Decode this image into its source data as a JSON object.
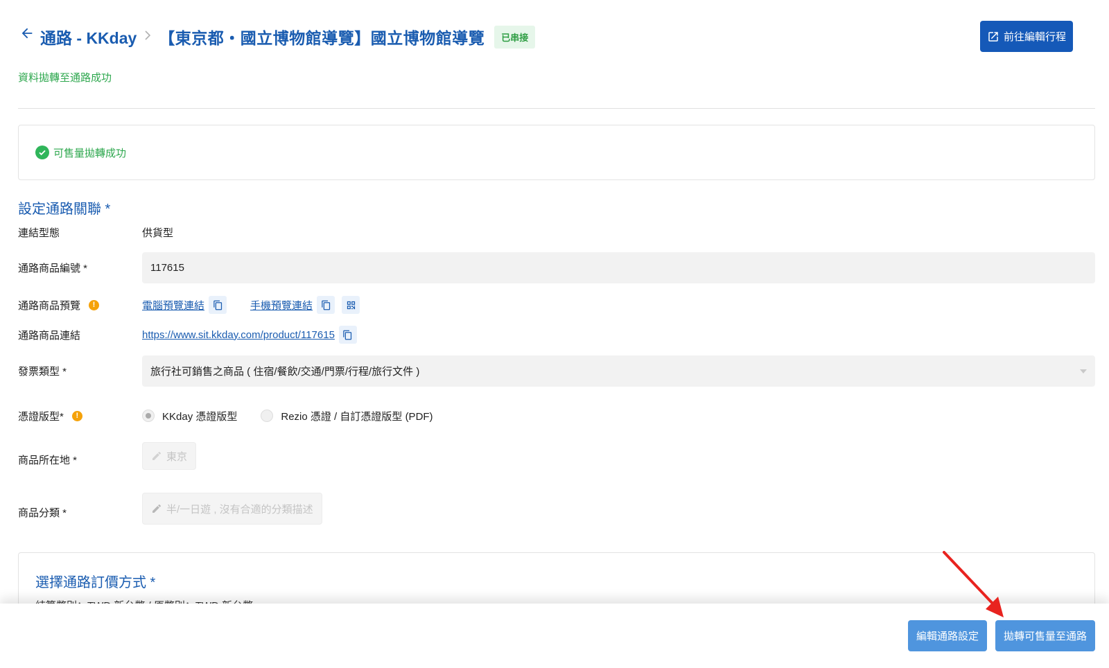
{
  "header": {
    "channel_label": "通路 - KKday",
    "product_title": "【東京都・國立博物館導覽】國立博物館導覽",
    "status_badge": "已串接",
    "edit_itinerary_label": "前往編輯行程"
  },
  "sync_message": "資料拋轉至通路成功",
  "success_card": {
    "message": "可售量拋轉成功"
  },
  "section_title": "設定通路關聯 *",
  "form": {
    "link_type": {
      "label": "連結型態",
      "value": "供貨型"
    },
    "product_id": {
      "label": "通路商品編號 *",
      "value": "117615"
    },
    "preview": {
      "label": "通路商品預覽",
      "desktop_link": "電腦預覽連結",
      "mobile_link": "手機預覽連結"
    },
    "product_link": {
      "label": "通路商品連結",
      "url": "https://www.sit.kkday.com/product/117615"
    },
    "invoice_type": {
      "label": "發票類型 *",
      "value": "旅行社可銷售之商品 ( 住宿/餐飲/交通/門票/行程/旅行文件 )"
    },
    "voucher_type": {
      "label": "憑證版型*",
      "option_a": "KKday 憑證版型",
      "option_b": "Rezio 憑證 / 自訂憑證版型 (PDF)",
      "selected": "option_a"
    },
    "location": {
      "label": "商品所在地 *",
      "value": "東京"
    },
    "category": {
      "label": "商品分類 *",
      "value": "半/一日遊 , 沒有合適的分類描述"
    }
  },
  "pricing": {
    "title": "選擇通路訂價方式 *",
    "currency_line": "結算幣別：TWD 新台幣 / 原幣別：TWD 新台幣"
  },
  "footer": {
    "edit_settings_label": "編輯通路設定",
    "sync_availability_label": "拋轉可售量至通路"
  },
  "colors": {
    "brand_blue": "#1a5cb0",
    "primary_button": "#1559b8",
    "footer_button": "#4f95de",
    "success_green": "#2fa84f",
    "annotation_red": "#e8231f"
  }
}
